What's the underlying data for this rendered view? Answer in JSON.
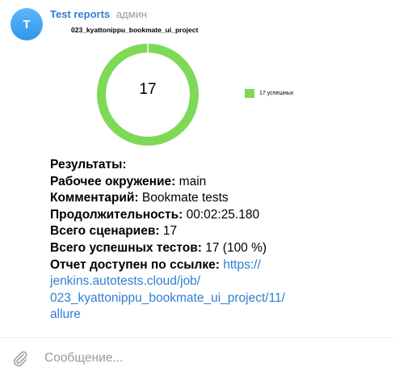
{
  "header": {
    "avatar_letter": "T",
    "sender_name": "Test reports",
    "sender_role": "админ"
  },
  "chart_data": {
    "type": "pie",
    "title": "023_kyattonippu_bookmate_ui_project",
    "center_label": "17",
    "categories": [
      "17 успешных"
    ],
    "values": [
      17
    ],
    "colors": [
      "#7ed957"
    ],
    "legend_position": "right"
  },
  "results": {
    "heading": "Результаты:",
    "env_label": "Рабочее окружение:",
    "env_value": "main",
    "comment_label": "Комментарий:",
    "comment_value": "Bookmate tests",
    "duration_label": "Продолжительность:",
    "duration_value": "00:02:25.180",
    "scenarios_label": "Всего сценариев:",
    "scenarios_value": "17",
    "passed_label": "Всего успешных тестов:",
    "passed_value": "17 (100 %)",
    "report_label": "Отчет доступен по ссылке:",
    "report_link_1": "https://",
    "report_link_2": "jenkins.autotests.cloud/job/",
    "report_link_3": "023_kyattonippu_bookmate_ui_project/11/",
    "report_link_4": "allure"
  },
  "composer": {
    "placeholder": "Сообщение...",
    "attach_icon": "paperclip-icon"
  }
}
